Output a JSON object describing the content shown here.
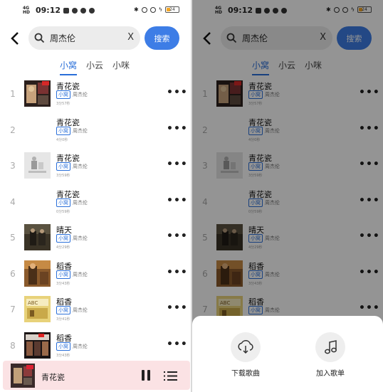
{
  "status_bar": {
    "network": "4G HD",
    "time": "09:12",
    "battery": "24"
  },
  "search": {
    "query": "周杰伦",
    "clear_label": "X",
    "button_label": "搜索"
  },
  "tabs": [
    {
      "label": "小窝",
      "active": true
    },
    {
      "label": "小云",
      "active": false
    },
    {
      "label": "小咪",
      "active": false
    }
  ],
  "songs": [
    {
      "index": "1",
      "title": "青花瓷",
      "source": "小窝",
      "artist": "周杰伦",
      "duration": "3分57秒",
      "cover": "art-collage"
    },
    {
      "index": "2",
      "title": "青花瓷",
      "source": "小窝",
      "artist": "周杰伦",
      "duration": "4分0秒",
      "cover": "none"
    },
    {
      "index": "3",
      "title": "青花瓷",
      "source": "小窝",
      "artist": "周杰伦",
      "duration": "3分59秒",
      "cover": "grey-sketch"
    },
    {
      "index": "4",
      "title": "青花瓷",
      "source": "小窝",
      "artist": "周杰伦",
      "duration": "0分59秒",
      "cover": "none"
    },
    {
      "index": "5",
      "title": "晴天",
      "source": "小窝",
      "artist": "周杰伦",
      "duration": "4分29秒",
      "cover": "dark-photo"
    },
    {
      "index": "6",
      "title": "稻香",
      "source": "小窝",
      "artist": "周杰伦",
      "duration": "3分43秒",
      "cover": "warm-photo"
    },
    {
      "index": "7",
      "title": "稻香",
      "source": "小窝",
      "artist": "周杰伦",
      "duration": "3分41秒",
      "cover": "yellow-art"
    },
    {
      "index": "8",
      "title": "稻香",
      "source": "小窝",
      "artist": "周杰伦",
      "duration": "3分43秒",
      "cover": "poster"
    }
  ],
  "player": {
    "title": "青花瓷"
  },
  "sheet": {
    "download_label": "下载歌曲",
    "add_to_playlist_label": "加入歌单"
  },
  "colors": {
    "accent": "#3d7de6",
    "player_bg": "#fbe2e4",
    "overlay": "#000000"
  }
}
